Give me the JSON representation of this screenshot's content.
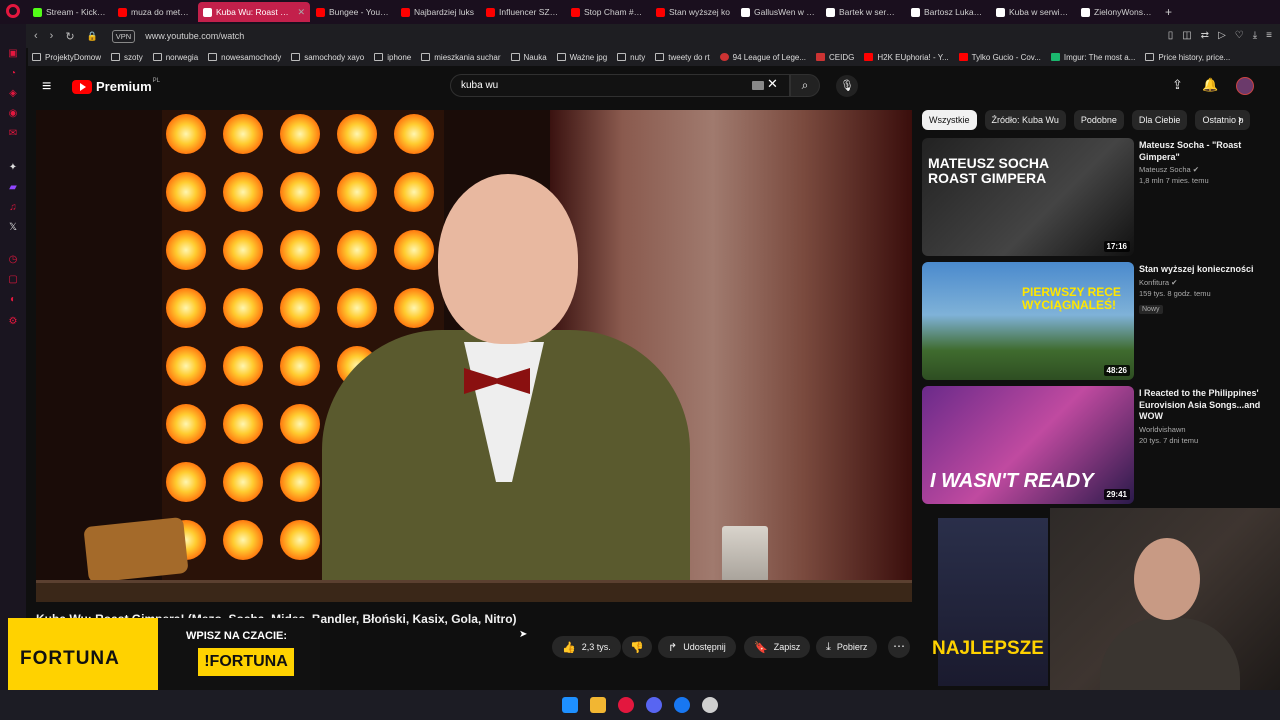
{
  "tabs": [
    {
      "title": "Stream - Kick Da",
      "color": "#53fc18",
      "active": false
    },
    {
      "title": "muza do metka t",
      "color": "#ff0000",
      "active": false
    },
    {
      "title": "Kuba Wu: Roast Gimpe",
      "color": "#ffffff",
      "active": true
    },
    {
      "title": "Bungee - YouTub",
      "color": "#ff0000",
      "active": false
    },
    {
      "title": "Najbardziej luks",
      "color": "#ff0000",
      "active": false
    },
    {
      "title": "Influencer SZYM",
      "color": "#ff0000",
      "active": false
    },
    {
      "title": "Stop Cham #150",
      "color": "#ff0000",
      "active": false
    },
    {
      "title": "Stan wyższej ko",
      "color": "#ff0000",
      "active": false
    },
    {
      "title": "GallusWen w se",
      "color": "#ffffff",
      "active": false
    },
    {
      "title": "Bartek w serwisi",
      "color": "#ffffff",
      "active": false
    },
    {
      "title": "Bartosz Lukas H",
      "color": "#ffffff",
      "active": false
    },
    {
      "title": "Kuba w serwisie",
      "color": "#ffffff",
      "active": false
    },
    {
      "title": "ZielonyWonsz w",
      "color": "#ffffff",
      "active": false
    }
  ],
  "address": {
    "vpn": "VPN",
    "url": "www.youtube.com/watch"
  },
  "bookmarks": [
    "ProjektyDomow",
    "szoty",
    "norwegia",
    "nowesamochody",
    "samochody xayo",
    "iphone",
    "mieszkania suchar",
    "Nauka",
    "Ważne jpg",
    "nuty",
    "tweety do rt",
    "94 League of Lege...",
    "CEIDG",
    "H2K EUphoria! - Y...",
    "Tylko Gucio - Cov...",
    "Imgur: The most a...",
    "Price history, price..."
  ],
  "youtube": {
    "brand": "Premium",
    "brand_sup": "PL",
    "search_value": "kuba wu",
    "video_title": "Kuba Wu: Roast Gimpera! (Mezo, Socha, Mides, Bandler, Błoński, Kasix, Gola, Nitro)",
    "actions": {
      "likes": "2,3 tys.",
      "share": "Udostępnij",
      "save": "Zapisz",
      "download": "Pobierz"
    },
    "chips": [
      "Wszystkie",
      "Źródło: Kuba Wu",
      "Podobne",
      "Dla Ciebie",
      "Ostatnio p"
    ],
    "recommendations": [
      {
        "title": "Mateusz Socha - \"Roast Gimpera\"",
        "channel": "Mateusz Socha",
        "meta": "1,8 mln  7 mies. temu",
        "duration": "17:16",
        "thumb_text": "MATEUSZ SOCHA ROAST GIMPERA",
        "badge": ""
      },
      {
        "title": "Stan wyższej konieczności",
        "channel": "Konfitura",
        "meta": "159 tys.  8 godz. temu",
        "duration": "48:26",
        "thumb_text": "PIERWSZY RECE WYCIĄGNALEŚ!",
        "badge": "Nowy"
      },
      {
        "title": "I Reacted to the Philippines' Eurovision Asia Songs...and WOW",
        "channel": "Worldvishawn",
        "meta": "20 tys.  7 dni temu",
        "duration": "29:41",
        "thumb_text": "I WASN'T READY",
        "badge": ""
      }
    ]
  },
  "overlay": {
    "brand": "FORTUNA",
    "cta": "WPISZ NA CZACIE:",
    "code": "!FORTUNA",
    "thumb_text": "NAJLEPSZE M"
  },
  "colors": {
    "youtube_red": "#ff0000",
    "opera_red": "#e3173e",
    "fortuna_yellow": "#ffd200"
  }
}
